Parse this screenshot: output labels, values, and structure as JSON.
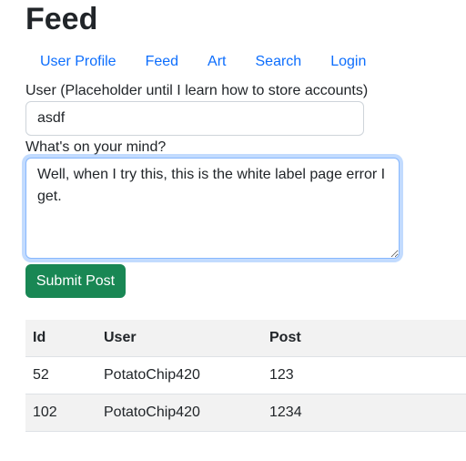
{
  "page": {
    "title": "Feed"
  },
  "nav": {
    "items": [
      {
        "label": "User Profile"
      },
      {
        "label": "Feed"
      },
      {
        "label": "Art"
      },
      {
        "label": "Search"
      },
      {
        "label": "Login"
      }
    ]
  },
  "form": {
    "user_label": "User (Placeholder until I learn how to store accounts)",
    "user_value": "asdf",
    "post_label": "What's on your mind?",
    "post_value": "Well, when I try this, this is the white label page error I get.",
    "submit_label": "Submit Post"
  },
  "table": {
    "headers": [
      "Id",
      "User",
      "Post"
    ],
    "rows": [
      {
        "id": "52",
        "user": "PotatoChip420",
        "post": "123"
      },
      {
        "id": "102",
        "user": "PotatoChip420",
        "post": "1234"
      }
    ]
  },
  "colors": {
    "link": "#0d6efd",
    "submit_bg": "#198754",
    "table_stripe": "#f2f2f2"
  }
}
